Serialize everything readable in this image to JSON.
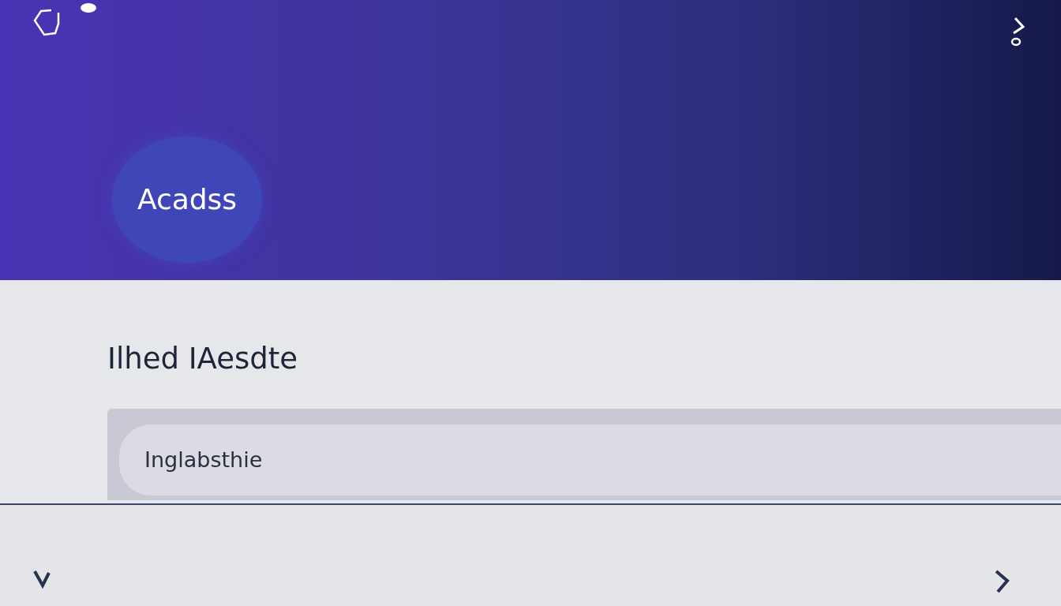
{
  "header": {
    "avatar_label": "Acadss"
  },
  "heading": "Ilhed IAesdte",
  "field": {
    "value": "Inglabsthie"
  }
}
